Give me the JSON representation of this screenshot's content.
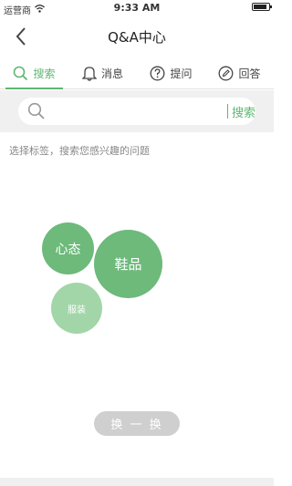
{
  "status": {
    "carrier": "运营商",
    "time": "9:33 AM"
  },
  "nav": {
    "title": "Q&A中心"
  },
  "tabs": [
    {
      "label": "搜索",
      "icon": "search-icon",
      "active": true
    },
    {
      "label": "消息",
      "icon": "bell-icon",
      "active": false
    },
    {
      "label": "提问",
      "icon": "question-icon",
      "active": false
    },
    {
      "label": "回答",
      "icon": "pencil-icon",
      "active": false
    }
  ],
  "search": {
    "value": "",
    "button_label": "搜索"
  },
  "hint": "选择标签，搜索您感兴趣的问题",
  "tags": [
    {
      "label": "心态"
    },
    {
      "label": "鞋品"
    },
    {
      "label": "服装"
    }
  ],
  "shuffle_label": "换 一 换",
  "colors": {
    "accent": "#5fb772",
    "bubble": "#6dba7b",
    "bubble_light": "#a2d6a8",
    "button_gray": "#cfcfcf"
  }
}
